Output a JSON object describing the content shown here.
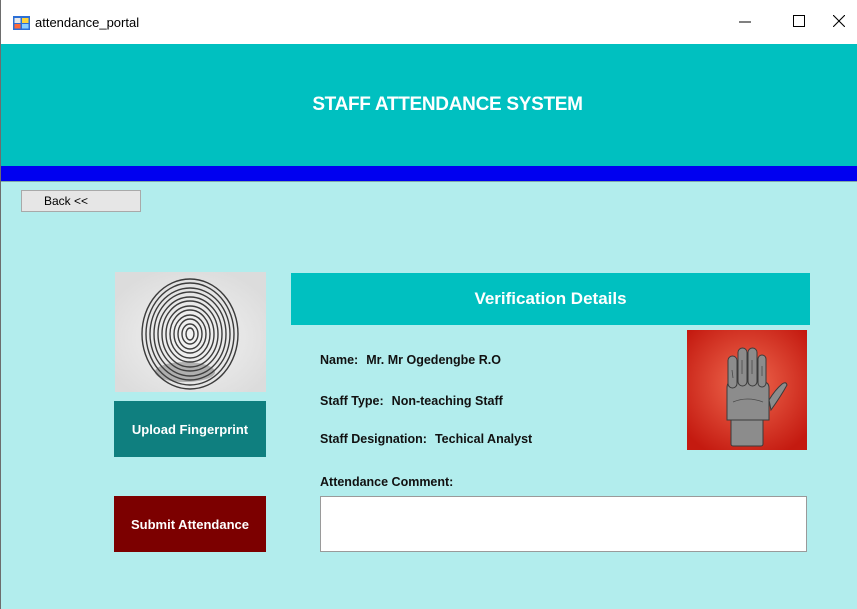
{
  "window": {
    "title": "attendance_portal",
    "controls": {
      "minimize": "minimize-icon",
      "maximize": "maximize-icon",
      "close": "close-icon"
    }
  },
  "header": {
    "title": "STAFF ATTENDANCE SYSTEM"
  },
  "nav": {
    "back_label": "Back <<"
  },
  "actions": {
    "upload_label": "Upload Fingerprint",
    "submit_label": "Submit Attendance"
  },
  "verification": {
    "title": "Verification Details",
    "name_label": "Name:",
    "name_value": "Mr. Mr Ogedengbe R.O",
    "staff_type_label": "Staff Type:",
    "staff_type_value": "Non-teaching Staff",
    "designation_label": "Staff Designation:",
    "designation_value": "Techical Analyst",
    "comment_label": "Attendance Comment:",
    "comment_value": ""
  },
  "images": {
    "fingerprint": "fingerprint-image",
    "hand": "hand-scan-image"
  },
  "colors": {
    "header": "#00c0c0",
    "accent_strip": "#0000f0",
    "background": "#b2eded",
    "upload_button": "#0f7f7f",
    "submit_button": "#7c0000"
  }
}
